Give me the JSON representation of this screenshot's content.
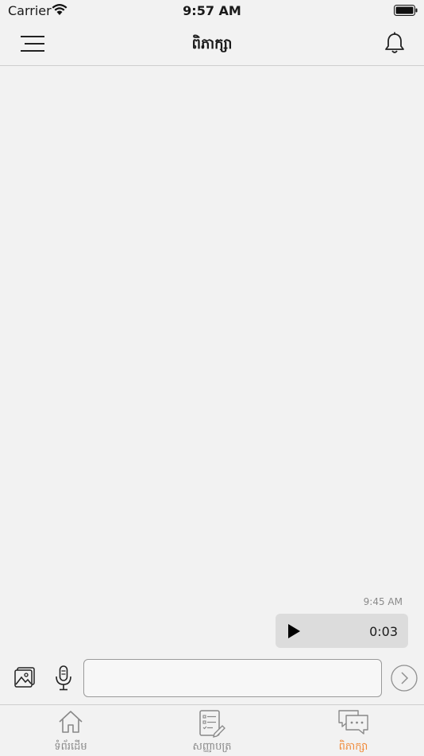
{
  "status_bar": {
    "carrier": "Carrier",
    "time": "9:57 AM"
  },
  "nav": {
    "title": "ពិភាក្សា",
    "menu_icon": "hamburger-icon",
    "bell_icon": "bell-icon"
  },
  "chat": {
    "messages": [
      {
        "type": "voice",
        "time": "9:45 AM",
        "duration": "0:03"
      }
    ]
  },
  "input_bar": {
    "message_value": "",
    "image_icon": "image-icon",
    "mic_icon": "microphone-icon",
    "send_icon": "send-icon"
  },
  "tabs": [
    {
      "label": "ទំព័រដើម",
      "icon": "home-icon",
      "active": false
    },
    {
      "label": "សញ្ញាបត្រ",
      "icon": "certificate-icon",
      "active": false
    },
    {
      "label": "ពិភាក្សា",
      "icon": "chat-icon",
      "active": true
    }
  ],
  "colors": {
    "accent": "#f08a3a",
    "background": "#f2f2f2",
    "bubble": "#dcdcdc"
  }
}
